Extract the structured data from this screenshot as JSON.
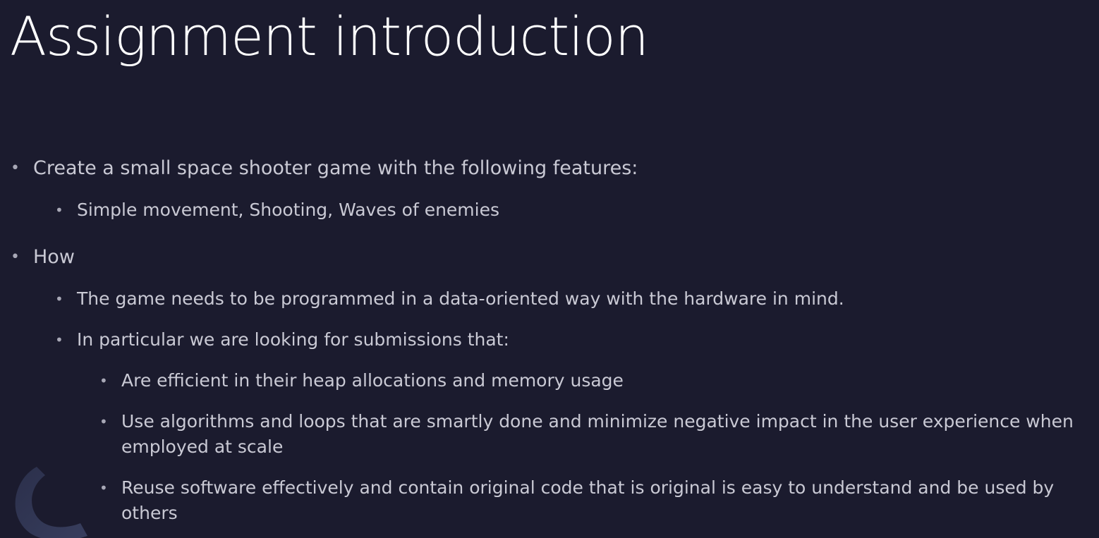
{
  "slide": {
    "title": "Assignment introduction",
    "bullets": [
      {
        "text": "Create a small space shooter game with the following features:",
        "children": [
          {
            "text": "Simple movement, Shooting, Waves of enemies"
          }
        ]
      },
      {
        "text": "How",
        "children": [
          {
            "text": "The game needs to be programmed in a data-oriented way with the hardware in mind."
          },
          {
            "text": "In particular we are looking for submissions that:",
            "children": [
              {
                "text": "Are efficient in their heap allocations and memory usage"
              },
              {
                "text": "Use algorithms and loops that are smartly done and minimize negative impact in the user experience when employed at scale"
              },
              {
                "text": "Reuse software effectively and contain original code that is original is easy to understand and be used by others"
              }
            ]
          }
        ]
      }
    ]
  },
  "bullet_glyph": "•",
  "colors": {
    "background": "#1b1b2e",
    "title": "#ffffff",
    "body_text": "#c9c9d4",
    "decoration": "#3a3f5c"
  },
  "decoration_icon": "arc-logo-icon"
}
